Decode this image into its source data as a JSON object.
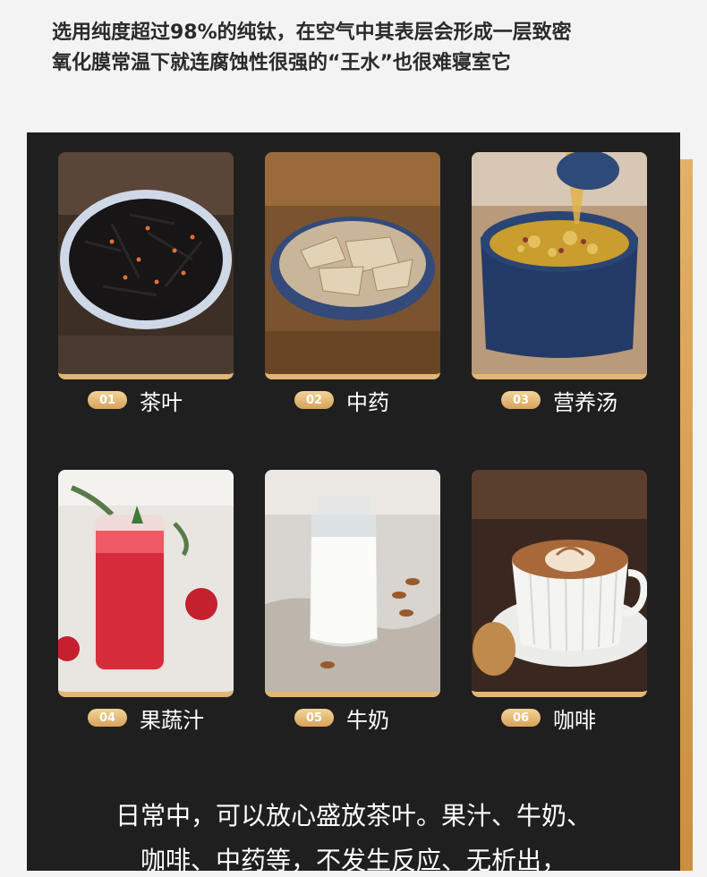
{
  "intro": {
    "line1": "选用纯度超过98%的纯钛，在空气中其表层会形成一层致密",
    "line2": "氧化膜常温下就连腐蚀性很强的“王水”也很难寝室它"
  },
  "items": [
    {
      "number": "01",
      "label": "茶叶",
      "icon": "tea-leaves-photo"
    },
    {
      "number": "02",
      "label": "中药",
      "icon": "herbal-medicine-photo"
    },
    {
      "number": "03",
      "label": "营养汤",
      "icon": "nutritious-soup-photo"
    },
    {
      "number": "04",
      "label": "果蔬汁",
      "icon": "fruit-juice-photo"
    },
    {
      "number": "05",
      "label": "牛奶",
      "icon": "milk-photo"
    },
    {
      "number": "06",
      "label": "咖啡",
      "icon": "coffee-photo"
    }
  ],
  "bottom": {
    "line1": "日常中，可以放心盛放茶叶。果汁、牛奶、",
    "line2": "咖啡、中药等，不发生反应、无析出，"
  },
  "colors": {
    "panel": "#1f1f1f",
    "gold": "#e3b673",
    "background": "#f3f3f3"
  }
}
